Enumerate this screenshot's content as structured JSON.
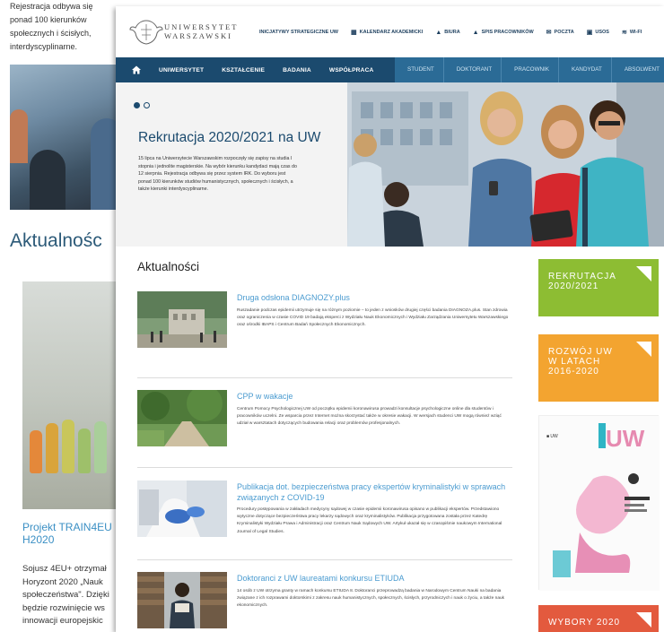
{
  "background_page": {
    "intro_lines": [
      "Rejestracja odbywa się",
      "ponad 100 kierunków",
      "społecznych i ścisłych,",
      "interdyscyplinarne."
    ],
    "section_heading": "Aktualnośc",
    "news_link": "Projekt TRAIN4EU H2020",
    "news_para": "Sojusz 4EU+ otrzymał Horyzont 2020 „Nauk społeczeństwa\". Dzięki będzie rozwinięcie ws innowacji europejskic"
  },
  "header": {
    "logo_name": "UNIWERSYTET\nWARSZAWSKI",
    "top_links": [
      {
        "icon": "",
        "label": "INICJATYWY STRATEGICZNE UW"
      },
      {
        "icon": "▦",
        "label": "KALENDARZ AKADEMICKI"
      },
      {
        "icon": "▲",
        "label": "BIURA"
      },
      {
        "icon": "▲",
        "label": "SPIS PRACOWNIKÓW"
      },
      {
        "icon": "✉",
        "label": "POCZTA"
      },
      {
        "icon": "▣",
        "label": "USOS"
      },
      {
        "icon": "≋",
        "label": "WI-FI"
      }
    ]
  },
  "nav": {
    "home_icon": "house",
    "main": [
      "UNIWERSYTET",
      "KSZTAŁCENIE",
      "BADANIA",
      "WSPÓŁPRACA"
    ],
    "secondary": [
      "STUDENT",
      "DOKTORANT",
      "PRACOWNIK",
      "KANDYDAT",
      "ABSOLWENT"
    ]
  },
  "hero": {
    "title": "Rekrutacja 2020/2021 na UW",
    "description": "15 lipca na Uniwersytecie Warszawskim rozpoczęły się zapisy na studia I stopnia i jednolite magisterskie. Na wybór kierunku kandydaci mają czas do 12 sierpnia. Rejestracja odbywa się przez system IRK. Do wyboru jest ponad 100 kierunków studiów humanistycznych, społecznych i ścisłych, a także kierunki interdyscyplinarne."
  },
  "news": {
    "heading": "Aktualności",
    "items": [
      {
        "title": "Druga odsłona DIAGNOZY.plus",
        "text": "Ruszadanie podczas epidemii utrzymuje się na różnym poziomie – to jeden z wniosków drugiej części badania DIAGNOZA.plus. Stan zdrowia oraz ograniczenia w czasie COVID 19 badają eksperci z Wydziału Nauk Ekonomicznych i Wydziału Zarządzania Uniwersytetu Warszawskiego oraz ośrodki IBAPS i Centrum Badań Społecznych Ekonomicznych."
      },
      {
        "title": "CPP w wakacje",
        "text": "Centrum Pomocy Psychologicznej UW od początku epidemii koronawirusa prowadzi konsultacje psychologiczne online dla studentów i pracowników uczelni. Ze wsparcia przez Internet można skorzystać także w okresie wakacji. W wersjach studenci UW mogą również wziąć udział w warsztatach dotyczących budowania relacji oraz problemów profesjonalnych."
      },
      {
        "title": "Publikacja dot. bezpieczeństwa pracy ekspertów kryminalistyki w sprawach związanych z COVID-19",
        "text": "Procedury postępowania w zakładach medycyny sądowej w czasie epidemii koronawirusa opisano w publikacji ekspertów. Przedstawiono wytyczne dotyczące bezpieczeństwa pracy lekarzy sądowych oraz kryminalistyków. Publikacja przygotowana została przez Katedrę Kryminalistyki Wydziału Prawa i Administracji oraz Centrum Nauk Sądowych UW. Artykuł ukazał się w czasopiśmie naukowym International Journal of Legal Studies."
      },
      {
        "title": "Doktoranci z UW laureatami konkursu ETIUDA",
        "text": "14 osób z UW otrzyma granty w ramach konkursu ETIUDA 8. Doktoranci przeprowadzą badania w Narodowym Centrum Nauki na badania związane z ich rozprawami doktorskimi z zakresu nauk humanistycznych, społecznych, ścisłych, przyrodniczych i nauk o życiu, a także nauk ekonomicznych."
      }
    ]
  },
  "sidebar": {
    "tiles": [
      "REKRUTACJA\n2020/2021",
      "ROZWÓJ UW\nW LATACH\n2016-2020",
      "WYBORY 2020"
    ],
    "poster_text": "UW",
    "poster_logo": "■ UW"
  },
  "colors": {
    "nav_primary": "#1b4a6e",
    "nav_secondary": "#2b6b96",
    "link_blue": "#4a9bd0",
    "tile_green": "#8dbd33",
    "tile_orange": "#f3a430",
    "tile_red": "#e35a3e"
  }
}
